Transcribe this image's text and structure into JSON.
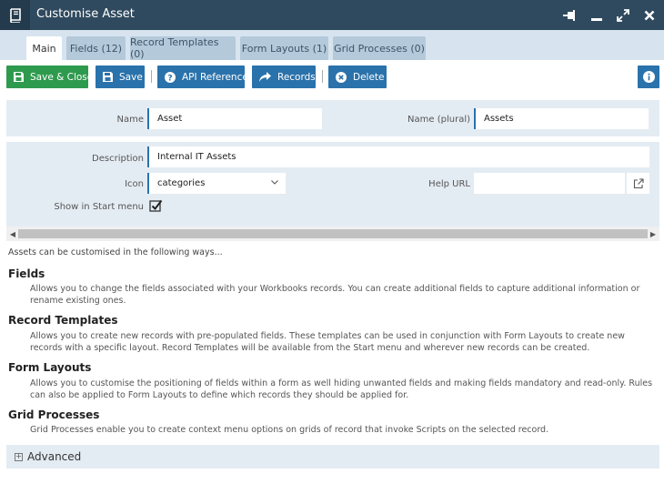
{
  "window": {
    "title": "Customise Asset"
  },
  "tabs": [
    {
      "label": "Main"
    },
    {
      "label": "Fields (12)"
    },
    {
      "label": "Record Templates (0)"
    },
    {
      "label": "Form Layouts (1)"
    },
    {
      "label": "Grid Processes (0)"
    }
  ],
  "toolbar": {
    "save_close": "Save & Close",
    "save": "Save",
    "api_reference": "API Reference",
    "records": "Records",
    "delete": "Delete"
  },
  "form": {
    "name_label": "Name",
    "name_value": "Asset",
    "name_plural_label": "Name (plural)",
    "name_plural_value": "Assets",
    "description_label": "Description",
    "description_value": "Internal IT Assets",
    "icon_label": "Icon",
    "icon_value": "categories",
    "help_url_label": "Help URL",
    "help_url_value": "",
    "start_menu_label": "Show in Start menu",
    "start_menu_checked": true
  },
  "info": {
    "intro": "Assets can be customised in the following ways...",
    "sections": [
      {
        "heading": "Fields",
        "text": "Allows you to change the fields associated with your Workbooks records. You can create additional fields to capture additional information or rename existing ones."
      },
      {
        "heading": "Record Templates",
        "text": "Allows you to create new records with pre-populated fields. These templates can be used in conjunction with Form Layouts to create new records with a specific layout. Record Templates will be available from the Start menu and wherever new records can be created."
      },
      {
        "heading": "Form Layouts",
        "text": "Allows you to customise the positioning of fields within a form as well hiding unwanted fields and making fields mandatory and read-only. Rules can also be applied to Form Layouts to define which records they should be applied for."
      },
      {
        "heading": "Grid Processes",
        "text": "Grid Processes enable you to create context menu options on grids of record that invoke Scripts on the selected record."
      }
    ]
  },
  "advanced": {
    "label": "Advanced"
  },
  "colors": {
    "title_bar": "#2f4a5e",
    "tab_bar": "#d7e4ef",
    "button_blue": "#2a72ab",
    "button_green": "#2e9a4e",
    "panel": "#e4ecf3"
  }
}
